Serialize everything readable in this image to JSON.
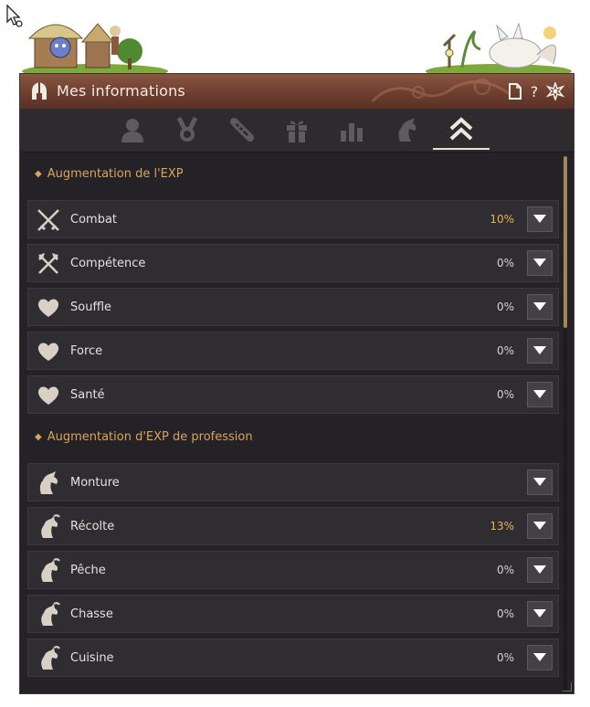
{
  "window": {
    "title": "Mes informations",
    "title_icon": "helmet-icon",
    "buttons": [
      {
        "name": "memo-button",
        "icon": "page-icon",
        "symbol": ""
      },
      {
        "name": "help-button",
        "icon": "question-icon",
        "symbol": "?"
      },
      {
        "name": "settings-button",
        "icon": "star-gear-icon",
        "symbol": ""
      }
    ]
  },
  "tabs": [
    {
      "name": "tab-profile",
      "icon": "person-icon",
      "active": false
    },
    {
      "name": "tab-medals",
      "icon": "medal-icon",
      "active": false
    },
    {
      "name": "tab-scroll",
      "icon": "scroll-icon",
      "active": false
    },
    {
      "name": "tab-gift",
      "icon": "gift-icon",
      "active": false
    },
    {
      "name": "tab-stats",
      "icon": "bar-chart-icon",
      "active": false
    },
    {
      "name": "tab-lifeskill",
      "icon": "horse-head-icon",
      "active": false
    },
    {
      "name": "tab-exp-boost",
      "icon": "double-chevron-up-icon",
      "active": true
    }
  ],
  "sections": {
    "exp": {
      "title": "Augmentation de l'EXP",
      "rows": [
        {
          "label": "Combat",
          "value": "10%",
          "icon": "crossed-swords-icon"
        },
        {
          "label": "Compétence",
          "value": "0%",
          "icon": "crossed-axes-icon"
        },
        {
          "label": "Souffle",
          "value": "0%",
          "icon": "heart-icon"
        },
        {
          "label": "Force",
          "value": "0%",
          "icon": "heart-icon"
        },
        {
          "label": "Santé",
          "value": "0%",
          "icon": "heart-icon"
        }
      ]
    },
    "profession": {
      "title": "Augmentation d'EXP de profession",
      "rows": [
        {
          "label": "Monture",
          "value": "",
          "icon": "horse-head-icon"
        },
        {
          "label": "Récolte",
          "value": "13%",
          "icon": "lifeskill-icon"
        },
        {
          "label": "Pêche",
          "value": "0%",
          "icon": "lifeskill-icon"
        },
        {
          "label": "Chasse",
          "value": "0%",
          "icon": "lifeskill-icon"
        },
        {
          "label": "Cuisine",
          "value": "0%",
          "icon": "lifeskill-icon"
        }
      ]
    }
  },
  "colors": {
    "accent": "#d9a45c",
    "titlebar": "#6d3e2f",
    "panel": "#242226",
    "row": "#2f2d31",
    "highlight_value": "#e8b152"
  }
}
